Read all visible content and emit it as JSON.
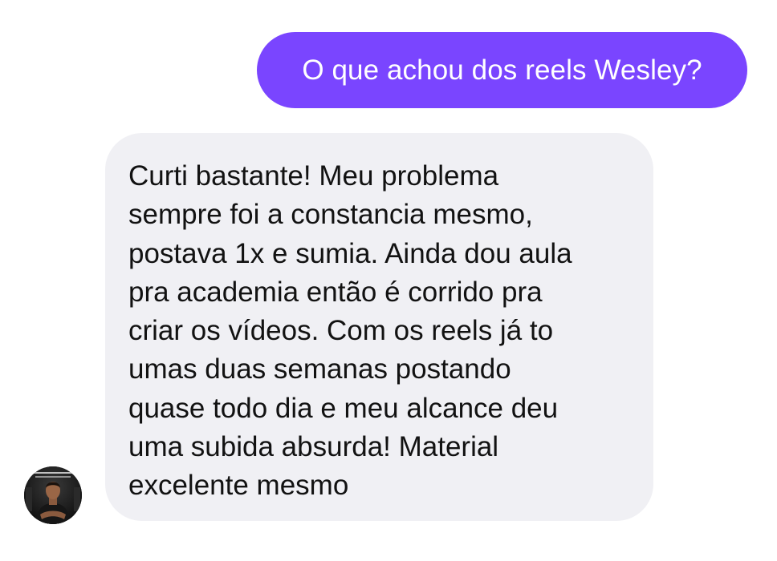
{
  "conversation": {
    "outgoing": {
      "text": "O que achou dos reels Wesley?",
      "color": "#7a45ff"
    },
    "incoming": {
      "text": "Curti bastante! Meu problema\nsempre foi a constancia mesmo,\npostava 1x e sumia. Ainda dou aula\npra academia então é corrido pra\ncriar os vídeos. Com os reels já to\numas duas semanas postando\nquase todo dia e meu alcance deu\numa subida absurda! Material\nexcelente mesmo",
      "color": "#f0f0f4"
    },
    "avatar": {
      "icon": "user-avatar-photo"
    }
  }
}
